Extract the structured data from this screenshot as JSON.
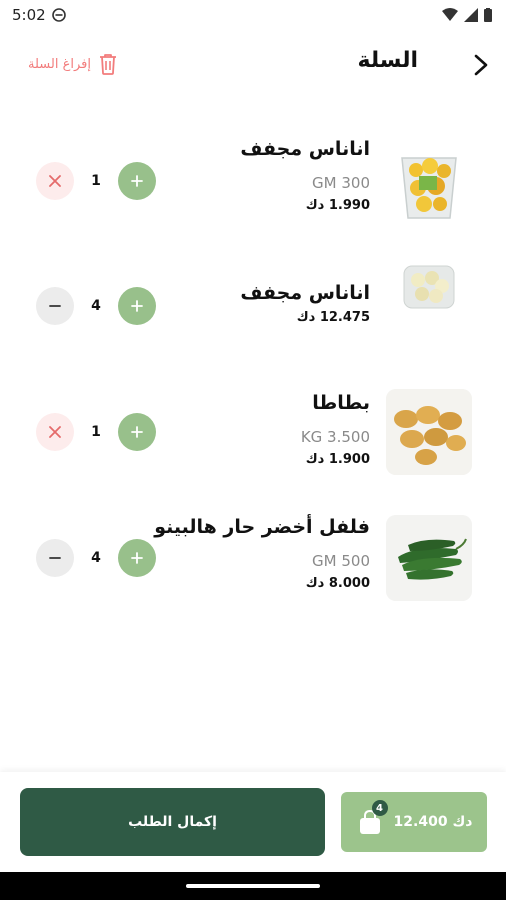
{
  "status_bar": {
    "time": "5:02"
  },
  "header": {
    "title": "السلة",
    "clear_label": "إفراغ السلة"
  },
  "items": [
    {
      "name": "اناناس مجفف",
      "weight": "GM 300",
      "price": "1.990 دك",
      "qty": "1",
      "image_icon": "dried-pineapple-cup-image",
      "left_action": "remove"
    },
    {
      "name": "اناناس مجفف",
      "weight": "",
      "price": "12.475 دك",
      "qty": "4",
      "image_icon": "dried-pineapple-pieces-image",
      "left_action": "minus"
    },
    {
      "name": "بطاطا",
      "weight": "KG 3.500",
      "price": "1.900 دك",
      "qty": "1",
      "image_icon": "potatoes-image",
      "left_action": "remove"
    },
    {
      "name": "فلفل أخضر حار هالبينو",
      "weight": "GM 500",
      "price": "8.000 دك",
      "qty": "4",
      "image_icon": "jalapeno-peppers-image",
      "left_action": "minus"
    }
  ],
  "footer": {
    "checkout_label": "إكمال الطلب",
    "total": "12.400 دك",
    "badge_count": "4"
  },
  "colors": {
    "accent_dark": "#2f5a45",
    "accent_light": "#98c08b",
    "danger": "#f27c7c"
  }
}
